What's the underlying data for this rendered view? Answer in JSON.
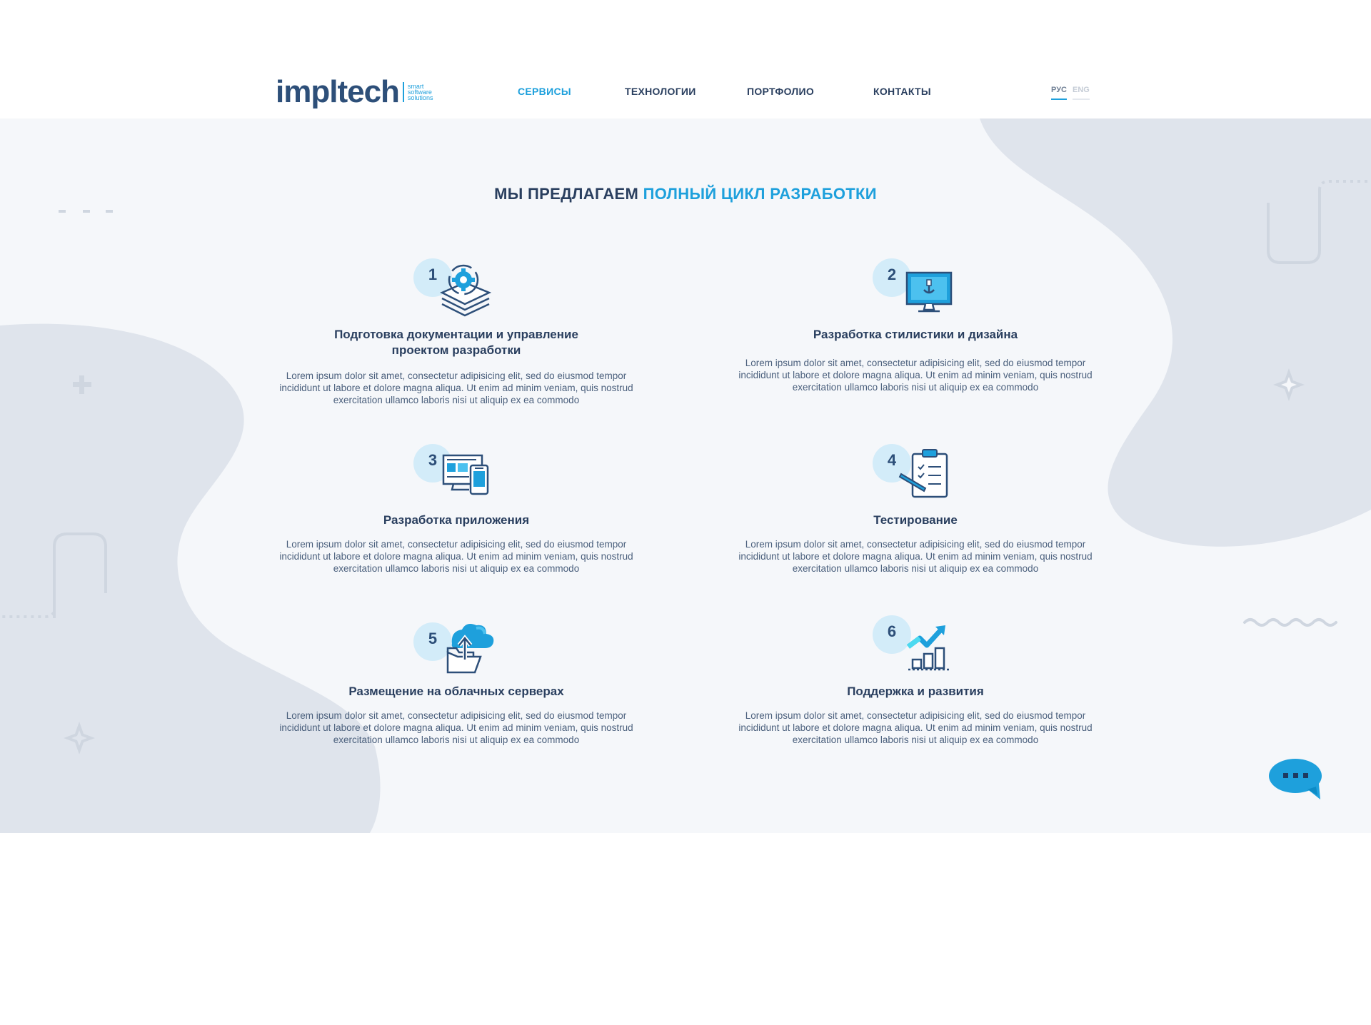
{
  "header": {
    "logo": {
      "word": "impltech",
      "tagline": [
        "smart",
        "software",
        "solutions"
      ]
    },
    "nav": [
      {
        "label": "СЕРВИСЫ",
        "active": true
      },
      {
        "label": "ТЕХНОЛОГИИ",
        "active": false
      },
      {
        "label": "ПОРТФОЛИО",
        "active": false
      },
      {
        "label": "КОНТАКТЫ",
        "active": false
      }
    ],
    "lang": {
      "ru": "РУС",
      "en": "ENG",
      "active": "ru"
    }
  },
  "section": {
    "title_main": "МЫ ПРЕДЛАГАЕМ",
    "title_accent": "ПОЛНЫЙ ЦИКЛ РАЗРАБОТКИ",
    "services": [
      {
        "num": "1",
        "icon": "documentation-gear-icon",
        "title": "Подготовка документации и управление проектом разработки",
        "text": "Lorem ipsum dolor sit amet, consectetur adipisicing elit, sed do eiusmod tempor incididunt ut labore et dolore magna aliqua. Ut enim ad minim veniam, quis nostrud exercitation ullamco laboris nisi ut aliquip ex ea commodo"
      },
      {
        "num": "2",
        "icon": "monitor-design-icon",
        "title": "Разработка стилистики и дизайна",
        "text": "Lorem ipsum dolor sit amet, consectetur adipisicing elit, sed do eiusmod tempor incididunt ut labore et dolore magna aliqua. Ut enim ad minim veniam, quis nostrud exercitation ullamco laboris nisi ut aliquip ex ea commodo"
      },
      {
        "num": "3",
        "icon": "devices-app-icon",
        "title": "Разработка приложения",
        "text": "Lorem ipsum dolor sit amet, consectetur adipisicing elit, sed do eiusmod tempor incididunt ut labore et dolore magna aliqua. Ut enim ad minim veniam, quis nostrud exercitation ullamco laboris nisi ut aliquip ex ea commodo"
      },
      {
        "num": "4",
        "icon": "clipboard-test-icon",
        "title": "Тестирование",
        "text": "Lorem ipsum dolor sit amet, consectetur adipisicing elit, sed do eiusmod tempor incididunt ut labore et dolore magna aliqua. Ut enim ad minim veniam, quis nostrud exercitation ullamco laboris nisi ut aliquip ex ea commodo"
      },
      {
        "num": "5",
        "icon": "cloud-upload-icon",
        "title": "Размещение на облачных серверах",
        "text": "Lorem ipsum dolor sit amet, consectetur adipisicing elit, sed do eiusmod tempor incididunt ut labore et dolore magna aliqua. Ut enim ad minim veniam, quis nostrud exercitation ullamco laboris nisi ut aliquip ex ea commodo"
      },
      {
        "num": "6",
        "icon": "growth-chart-icon",
        "title": "Поддержка и развития",
        "text": "Lorem ipsum dolor sit amet, consectetur adipisicing elit, sed do eiusmod tempor incididunt ut labore et dolore magna aliqua. Ut enim ad minim veniam, quis nostrud exercitation ullamco laboris nisi ut aliquip ex ea commodo"
      }
    ]
  },
  "chat": {
    "icon": "chat-bubble-icon"
  },
  "colors": {
    "accent": "#1ea0dc",
    "dark": "#2a3f5f",
    "bg": "#f5f7fa",
    "blob": "#dfe4ec",
    "num_circle": "#d3ecf9"
  }
}
